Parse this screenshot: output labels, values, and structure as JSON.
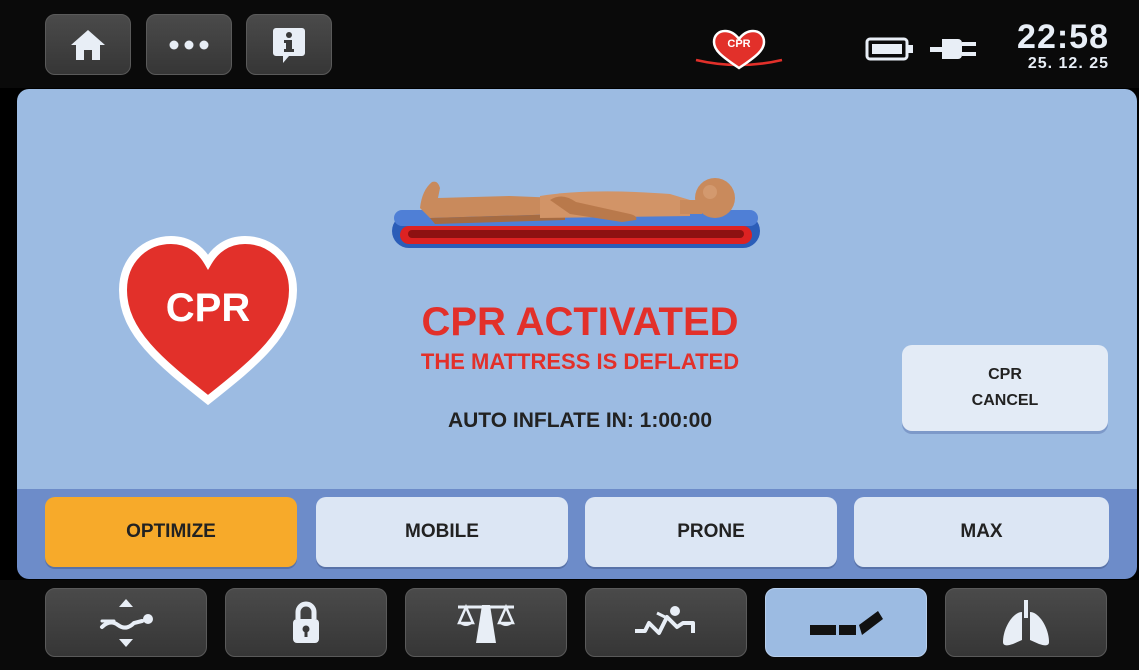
{
  "topbar": {
    "home_icon": "home-icon",
    "more_icon": "more-dots-icon",
    "info_icon": "info-icon",
    "cpr_indicator": "CPR",
    "battery_icon": "battery-icon",
    "plug_icon": "plug-icon",
    "time": "22:58",
    "date": "25. 12. 25"
  },
  "main": {
    "cpr_heart_label": "CPR",
    "title": "CPR ACTIVATED",
    "subtitle": "THE MATTRESS IS DEFLATED",
    "auto_inflate": "AUTO INFLATE IN: 1:00:00",
    "cancel_line1": "CPR",
    "cancel_line2": "CANCEL"
  },
  "modes": [
    {
      "label": "OPTIMIZE",
      "active": true
    },
    {
      "label": "MOBILE",
      "active": false
    },
    {
      "label": "PRONE",
      "active": false
    },
    {
      "label": "MAX",
      "active": false
    }
  ],
  "bottom_nav": [
    {
      "icon": "pressure-adjust-icon",
      "active": false
    },
    {
      "icon": "lock-icon",
      "active": false
    },
    {
      "icon": "scale-icon",
      "active": false
    },
    {
      "icon": "patient-turn-icon",
      "active": false
    },
    {
      "icon": "mattress-icon",
      "active": true
    },
    {
      "icon": "lungs-icon",
      "active": false
    }
  ],
  "colors": {
    "accent_red": "#e2302a",
    "panel_blue": "#9cbbe2",
    "active_orange": "#f7aa2a"
  }
}
